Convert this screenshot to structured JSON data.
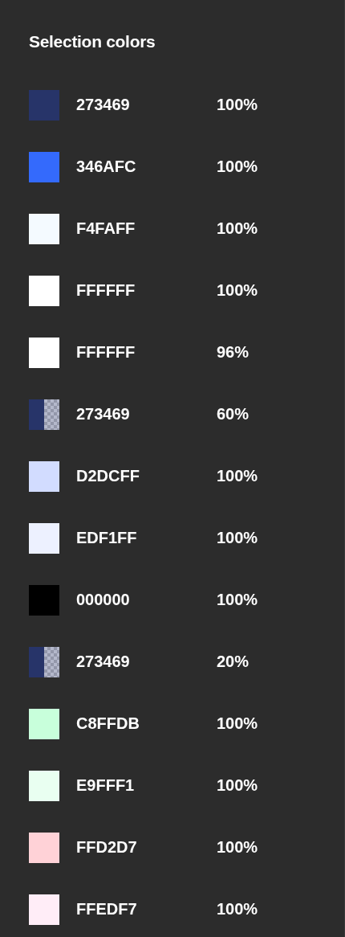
{
  "panel": {
    "title": "Selection colors"
  },
  "colors": [
    {
      "color": "#273469",
      "hex": "273469",
      "opacity": "100%",
      "kind": "solid"
    },
    {
      "color": "#346afc",
      "hex": "346AFC",
      "opacity": "100%",
      "kind": "solid"
    },
    {
      "color": "#f4faff",
      "hex": "F4FAFF",
      "opacity": "100%",
      "kind": "solid"
    },
    {
      "color": "#ffffff",
      "hex": "FFFFFF",
      "opacity": "100%",
      "kind": "solid"
    },
    {
      "color": "#ffffff",
      "hex": "FFFFFF",
      "opacity": "96%",
      "kind": "solid"
    },
    {
      "color": "#273469",
      "hex": "273469",
      "opacity": "60%",
      "kind": "translucent"
    },
    {
      "color": "#d2dcff",
      "hex": "D2DCFF",
      "opacity": "100%",
      "kind": "solid"
    },
    {
      "color": "#edf1ff",
      "hex": "EDF1FF",
      "opacity": "100%",
      "kind": "solid"
    },
    {
      "color": "#000000",
      "hex": "000000",
      "opacity": "100%",
      "kind": "solid"
    },
    {
      "color": "#273469",
      "hex": "273469",
      "opacity": "20%",
      "kind": "translucent"
    },
    {
      "color": "#c8ffdb",
      "hex": "C8FFDB",
      "opacity": "100%",
      "kind": "solid"
    },
    {
      "color": "#e9fff1",
      "hex": "E9FFF1",
      "opacity": "100%",
      "kind": "solid"
    },
    {
      "color": "#ffd2d7",
      "hex": "FFD2D7",
      "opacity": "100%",
      "kind": "solid"
    },
    {
      "color": "#ffedf7",
      "hex": "FFEDF7",
      "opacity": "100%",
      "kind": "solid"
    }
  ]
}
